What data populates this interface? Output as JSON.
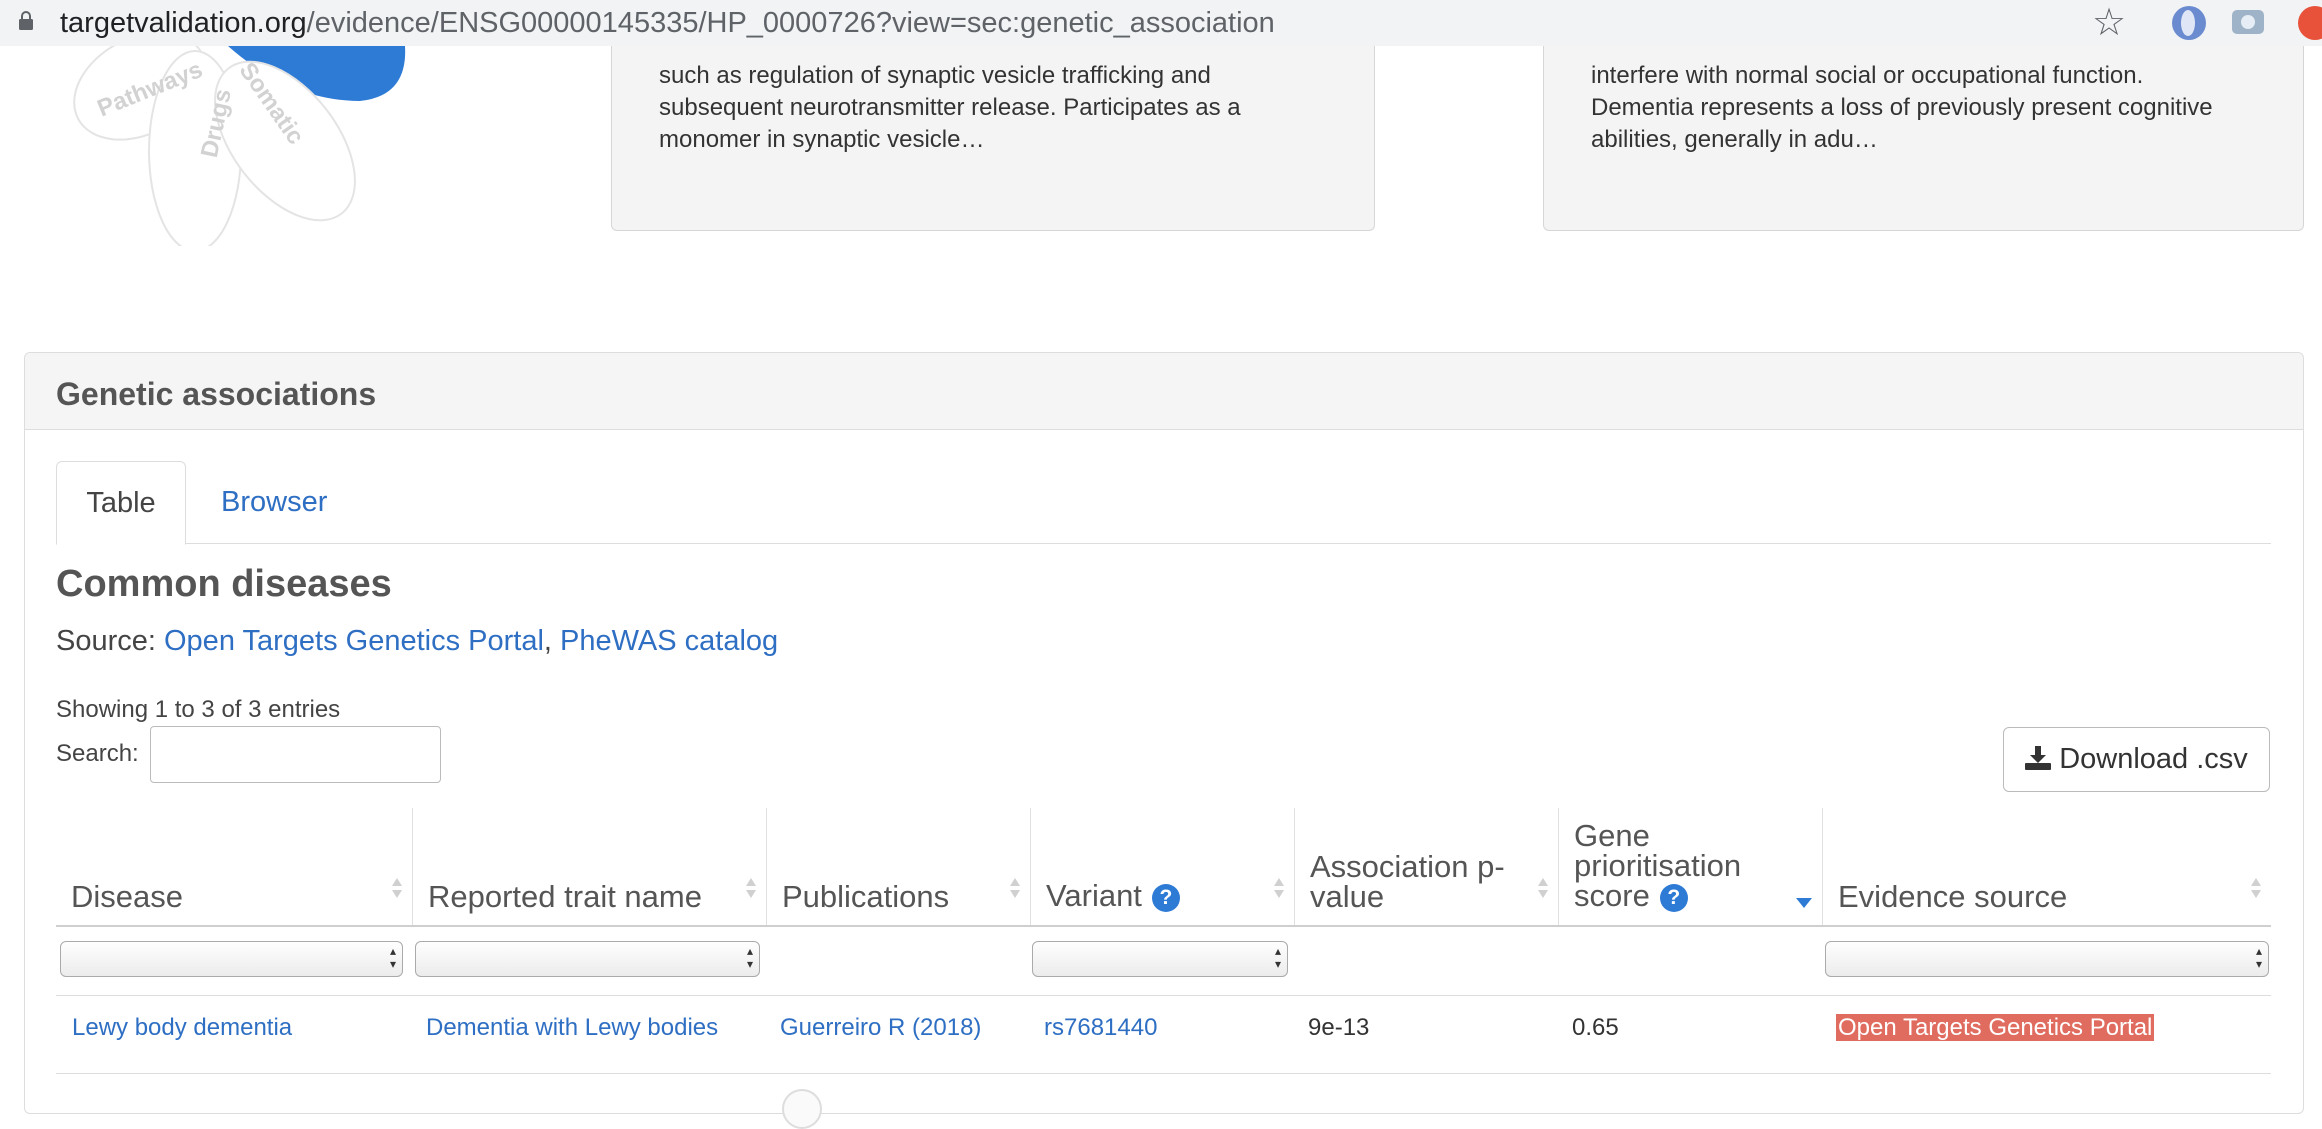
{
  "browser": {
    "url_host": "targetvalidation.org",
    "url_path": "/evidence/ENSG00000145335/HP_0000726?view=sec:genetic_association"
  },
  "flower": {
    "petals": [
      "Pathways",
      "Drugs",
      "Somatic"
    ]
  },
  "summary_cards": {
    "target_text": "such as regulation of synaptic vesicle trafficking and\nsubsequent neurotransmitter release. Participates as a\nmonomer in synaptic vesicle…",
    "disease_text": "interfere with normal social or occupational function.\nDementia represents a loss of previously present cognitive\nabilities, generally in adu…"
  },
  "panel": {
    "title": "Genetic associations",
    "tabs": [
      {
        "label": "Table",
        "active": true
      },
      {
        "label": "Browser",
        "active": false
      }
    ],
    "section_title": "Common diseases",
    "source_prefix": "Source: ",
    "sources": [
      "Open Targets Genetics Portal",
      "PheWAS catalog"
    ],
    "source_separator": ",",
    "entries_info": "Showing 1 to 3 of 3 entries",
    "search_label": "Search:",
    "search_value": "",
    "download_label": "Download .csv"
  },
  "table": {
    "columns": [
      "Disease",
      "Reported trait name",
      "Publications",
      "Variant",
      "Association p-\nvalue",
      "Gene\nprioritisation\nscore",
      "Evidence source"
    ],
    "help_icon": "?",
    "rows": [
      {
        "disease": "Lewy body dementia",
        "reported_trait": "Dementia with Lewy bodies",
        "publication": "Guerreiro R (2018)",
        "variant": "rs7681440",
        "p_value": "9e-13",
        "score": "0.65",
        "evidence_source": "Open Targets Genetics Portal"
      }
    ]
  },
  "colors": {
    "link": "#2e6fc3",
    "help_icon": "#2e7bd6",
    "evidence_highlight": "#e06c5f"
  }
}
